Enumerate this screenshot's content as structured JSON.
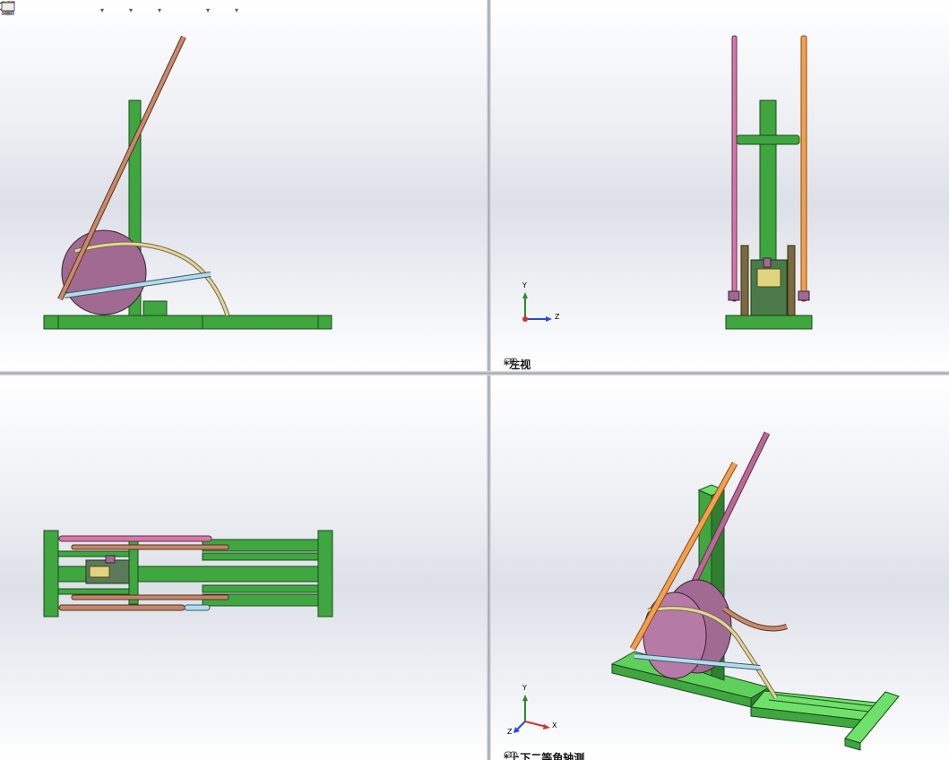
{
  "toolbar": {
    "icons": [
      "origin-icon",
      "zoom-to-fit-icon",
      "zoom-area-icon",
      "previous-view-icon",
      "section-view-icon",
      "view-orientation-icon",
      "display-style-icon",
      "hide-show-icon",
      "edit-appearance-icon",
      "apply-scene-icon",
      "view-settings-icon"
    ],
    "dropdown_glyph": "▾"
  },
  "viewports": {
    "top_left": {
      "label": ""
    },
    "top_right": {
      "label": "*左视",
      "triad": {
        "y": "Y",
        "z": "Z"
      }
    },
    "bottom_left": {
      "label": ""
    },
    "bottom_right": {
      "label": "*上下二等角轴测",
      "triad": {
        "y": "Y",
        "x": "X",
        "z": "Z"
      }
    }
  },
  "colors": {
    "frame_green": "#3fa640",
    "frame_green_light": "#6fe06a",
    "wheel_purple": "#a06a93",
    "rod_brown": "#c0876a",
    "rod_pink": "#d37aa8",
    "rod_orange": "#f0a050",
    "rod_blue": "#a8d8e8",
    "curve_tan": "#d8c890"
  }
}
